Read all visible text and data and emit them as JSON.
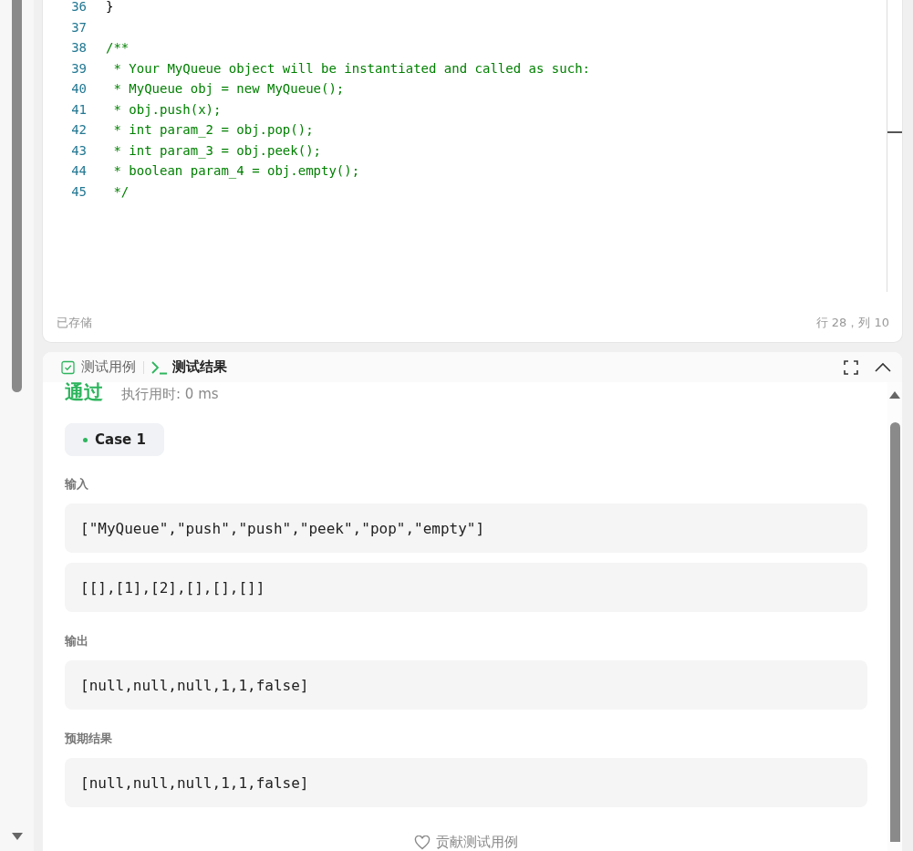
{
  "editor": {
    "lines": [
      {
        "number": "36",
        "text": "}",
        "kind": "code"
      },
      {
        "number": "37"
      },
      {
        "number": "38",
        "text": "/**",
        "kind": "comment"
      },
      {
        "number": "39",
        "text": " * Your MyQueue object will be instantiated and called as such:",
        "kind": "comment"
      },
      {
        "number": "40",
        "text": " * MyQueue obj = new MyQueue();",
        "kind": "comment"
      },
      {
        "number": "41",
        "text": " * obj.push(x);",
        "kind": "comment"
      },
      {
        "number": "42",
        "text": " * int param_2 = obj.pop();",
        "kind": "comment"
      },
      {
        "number": "43",
        "text": " * int param_3 = obj.peek();",
        "kind": "comment"
      },
      {
        "number": "44",
        "text": " * boolean param_4 = obj.empty();",
        "kind": "comment"
      },
      {
        "number": "45",
        "text": " */",
        "kind": "comment"
      }
    ],
    "status": "已存储",
    "cursor": "行 28，列 10"
  },
  "panel": {
    "tabs": [
      {
        "label": "测试用例",
        "kind": "cases",
        "selected": false
      },
      {
        "label": "测试结果",
        "kind": "results",
        "selected": true
      }
    ],
    "result": "通过",
    "runtime": "执行用时: 0 ms",
    "cases": [
      {
        "label": "Case 1",
        "selected": true,
        "passed": true
      }
    ],
    "sections": [
      {
        "label": "输入",
        "values": [
          "[\"MyQueue\",\"push\",\"push\",\"peek\",\"pop\",\"empty\"]",
          "[[],[1],[2],[],[],[]]"
        ]
      },
      {
        "label": "输出",
        "values": [
          "[null,null,null,1,1,false]"
        ]
      },
      {
        "label": "预期结果",
        "values": [
          "[null,null,null,1,1,false]"
        ]
      }
    ],
    "contribute": "贡献测试用例"
  }
}
